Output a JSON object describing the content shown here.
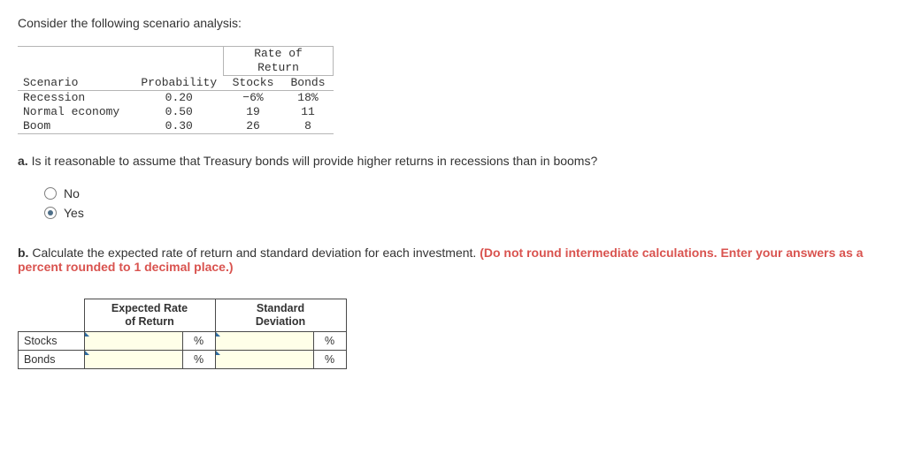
{
  "intro_text": "Consider the following scenario analysis:",
  "scenario_table": {
    "rate_of": "Rate of",
    "return": "Return",
    "hdr_scenario": "Scenario",
    "hdr_probability": "Probability",
    "hdr_stocks": "Stocks",
    "hdr_bonds": "Bonds",
    "rows": [
      {
        "name": "Recession",
        "prob": "0.20",
        "stocks": "−6%",
        "bonds": "18%"
      },
      {
        "name": "Normal economy",
        "prob": "0.50",
        "stocks": "19",
        "bonds": "11"
      },
      {
        "name": "Boom",
        "prob": "0.30",
        "stocks": "26",
        "bonds": "8"
      }
    ]
  },
  "question_a": {
    "label": "a.",
    "text": "Is it reasonable to assume that Treasury bonds will provide higher returns in recessions than in booms?",
    "options": {
      "no": "No",
      "yes": "Yes"
    },
    "selected": "yes"
  },
  "question_b": {
    "label": "b.",
    "text_plain": "Calculate the expected rate of return and standard deviation for each investment. ",
    "text_red": "(Do not round intermediate calculations. Enter your answers as a percent rounded to 1 decimal place.)"
  },
  "answer_table": {
    "hdr_expected_l1": "Expected Rate",
    "hdr_expected_l2": "of Return",
    "hdr_stddev_l1": "Standard",
    "hdr_stddev_l2": "Deviation",
    "rows": [
      {
        "name": "Stocks",
        "expected": "",
        "stddev": ""
      },
      {
        "name": "Bonds",
        "expected": "",
        "stddev": ""
      }
    ],
    "unit": "%"
  },
  "chart_data": {
    "type": "table",
    "title": "Scenario analysis: rate of return",
    "columns": [
      "Scenario",
      "Probability",
      "Stocks (%)",
      "Bonds (%)"
    ],
    "rows": [
      [
        "Recession",
        0.2,
        -6,
        18
      ],
      [
        "Normal economy",
        0.5,
        19,
        11
      ],
      [
        "Boom",
        0.3,
        26,
        8
      ]
    ]
  }
}
